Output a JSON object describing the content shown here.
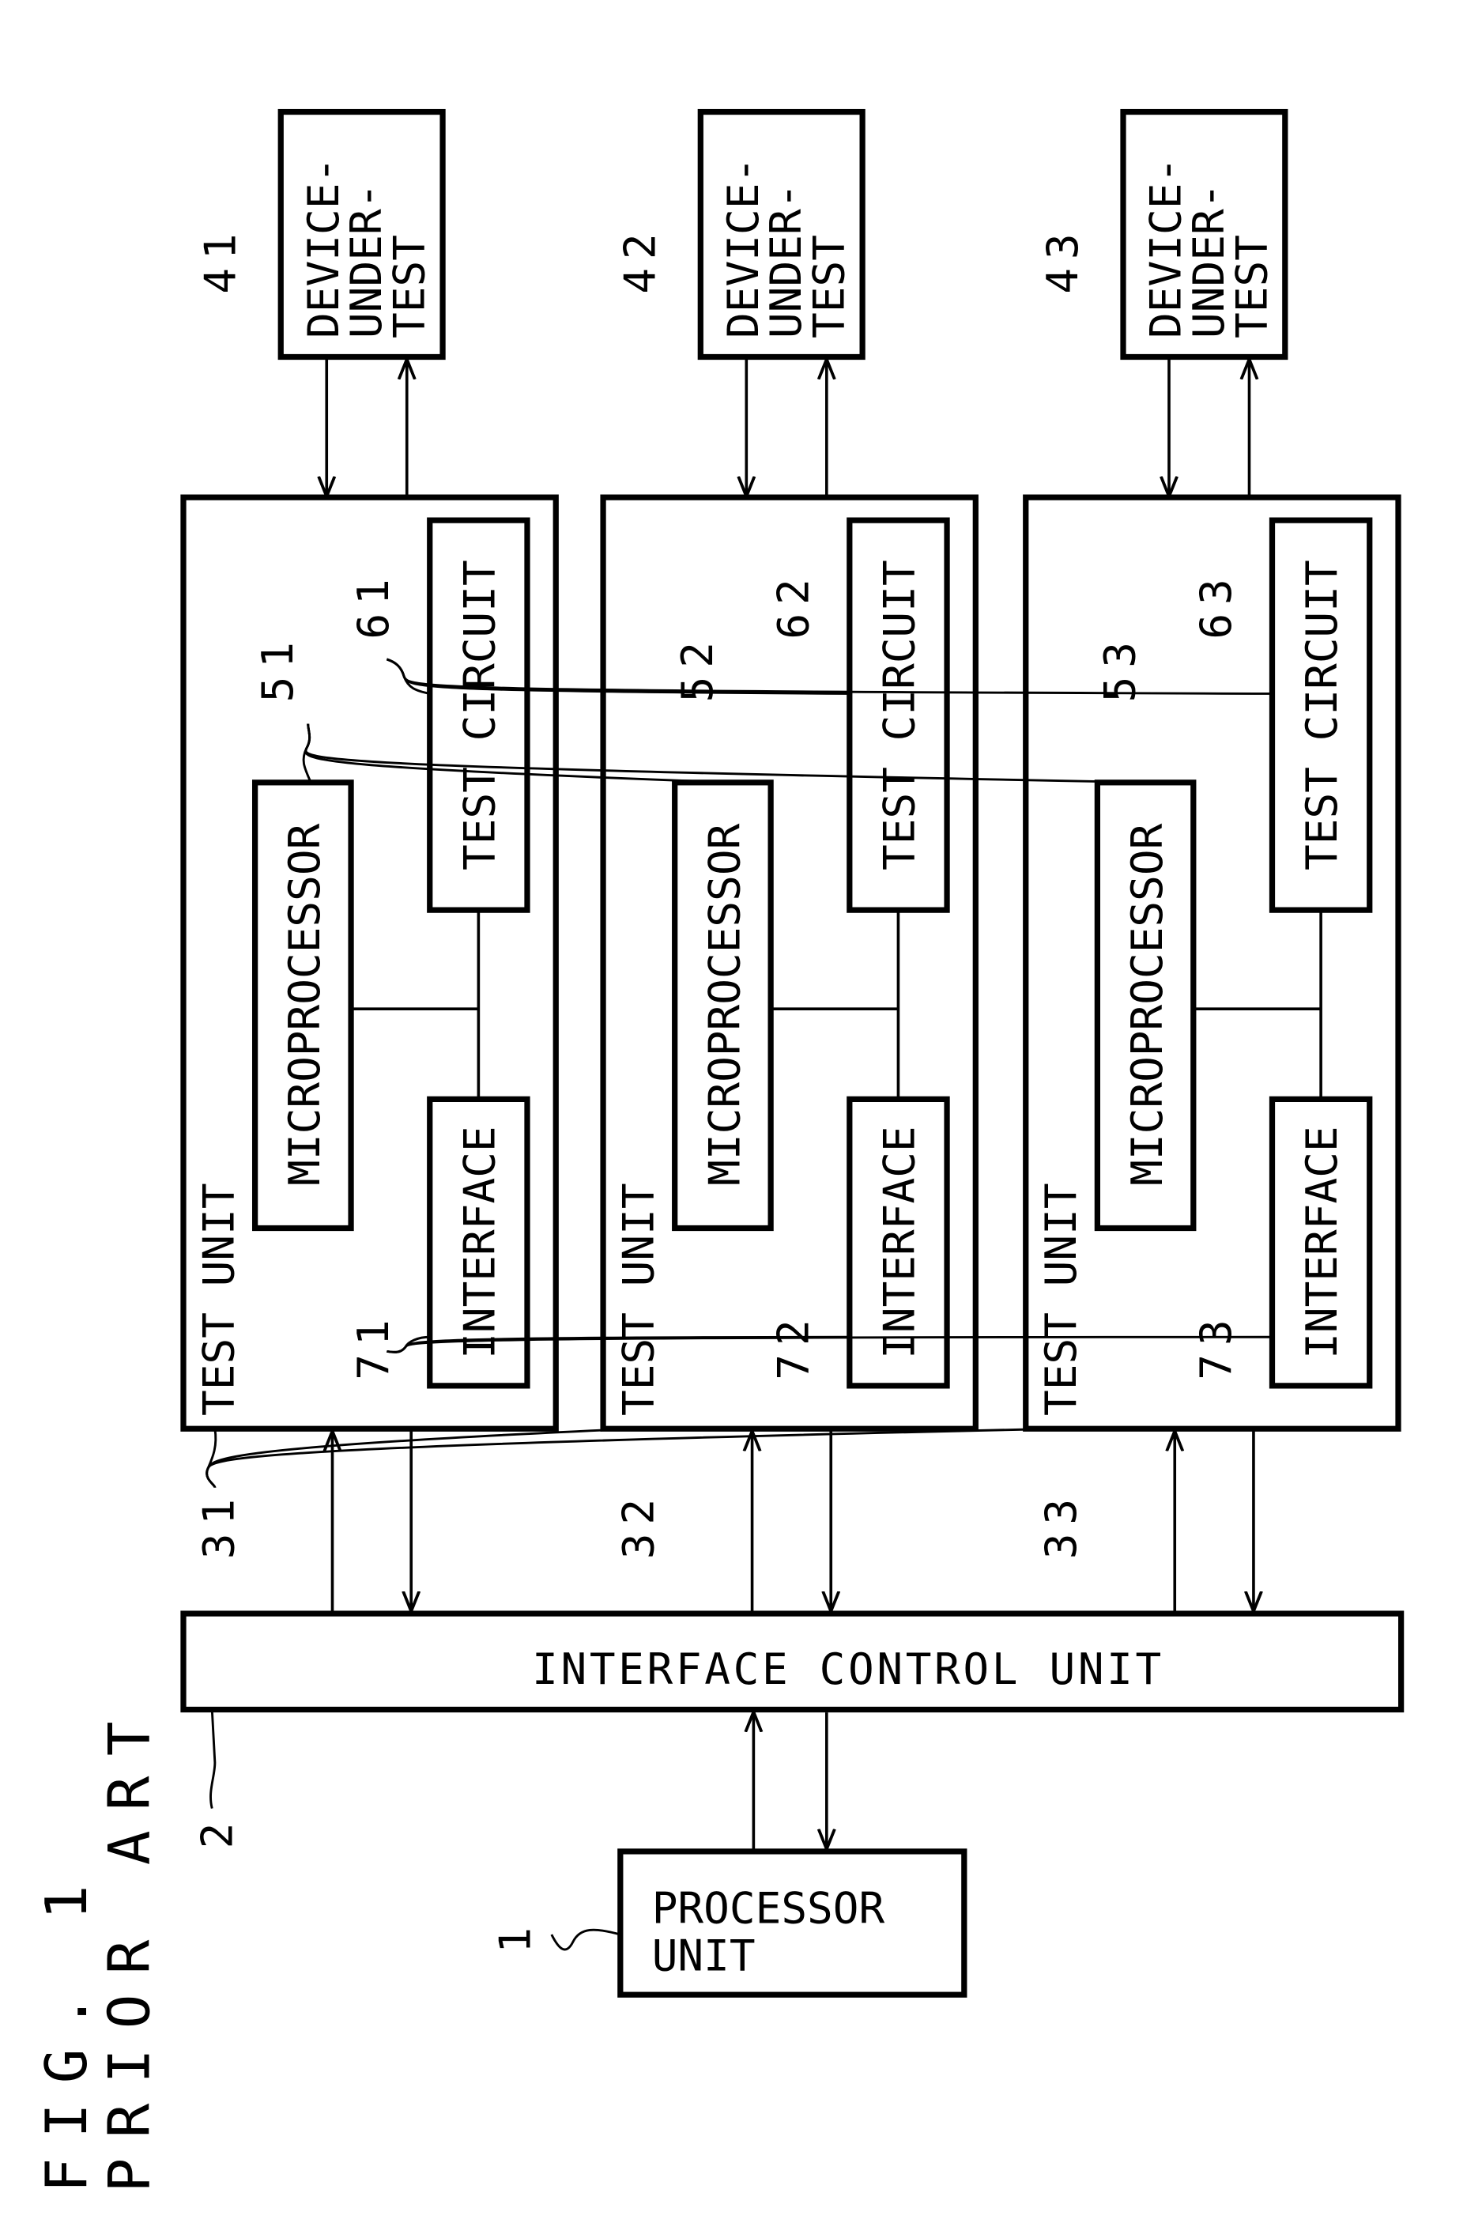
{
  "figure": {
    "title": "FIG. 1",
    "subtitle": "PRIOR ART"
  },
  "processor_unit": {
    "ref": "1",
    "lines": [
      "PROCESSOR",
      "UNIT"
    ]
  },
  "interface_control_unit": {
    "ref": "2",
    "label": "INTERFACE CONTROL UNIT"
  },
  "test_units": [
    {
      "ref": "31",
      "label": "TEST UNIT",
      "microprocessor": {
        "ref": "51",
        "label": "MICROPROCESSOR"
      },
      "test_circuit": {
        "ref": "61",
        "label": "TEST CIRCUIT"
      },
      "interface": {
        "ref": "71",
        "label": "INTERFACE"
      },
      "device_under_test": {
        "ref": "41",
        "lines": [
          "DEVICE-",
          "UNDER-",
          "TEST"
        ]
      }
    },
    {
      "ref": "32",
      "label": "TEST UNIT",
      "microprocessor": {
        "ref": "52",
        "label": "MICROPROCESSOR"
      },
      "test_circuit": {
        "ref": "62",
        "label": "TEST CIRCUIT"
      },
      "interface": {
        "ref": "72",
        "label": "INTERFACE"
      },
      "device_under_test": {
        "ref": "42",
        "lines": [
          "DEVICE-",
          "UNDER-",
          "TEST"
        ]
      }
    },
    {
      "ref": "33",
      "label": "TEST UNIT",
      "microprocessor": {
        "ref": "53",
        "label": "MICROPROCESSOR"
      },
      "test_circuit": {
        "ref": "63",
        "label": "TEST CIRCUIT"
      },
      "interface": {
        "ref": "73",
        "label": "INTERFACE"
      },
      "device_under_test": {
        "ref": "43",
        "lines": [
          "DEVICE-",
          "UNDER-",
          "TEST"
        ]
      }
    }
  ]
}
